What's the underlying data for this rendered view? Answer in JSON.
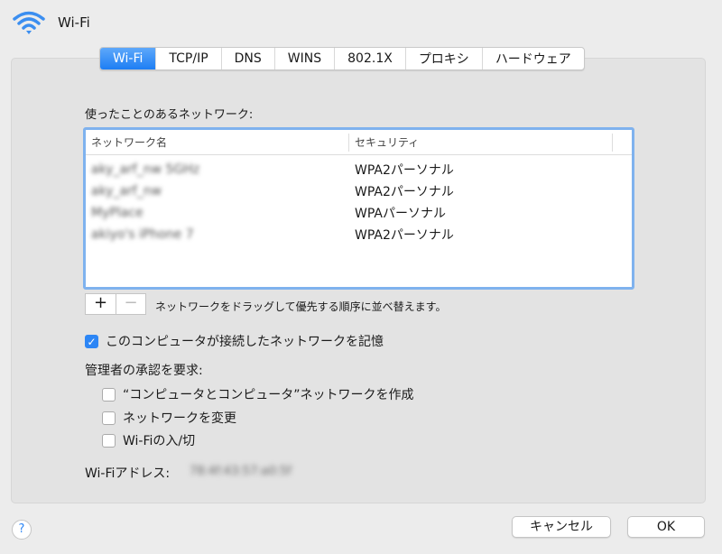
{
  "header": {
    "title": "Wi-Fi",
    "icon": "wifi-icon"
  },
  "tabs": [
    "Wi-Fi",
    "TCP/IP",
    "DNS",
    "WINS",
    "802.1X",
    "プロキシ",
    "ハードウェア"
  ],
  "preferred_label": "使ったことのあるネットワーク:",
  "table": {
    "columns": [
      "ネットワーク名",
      "セキュリティ"
    ],
    "rows": [
      {
        "name": "aky_arf_nw 5GHz",
        "security": "WPA2パーソナル"
      },
      {
        "name": "aky_arf_nw",
        "security": "WPA2パーソナル"
      },
      {
        "name": "MyPlace",
        "security": "WPAパーソナル"
      },
      {
        "name": "akiyo's iPhone 7",
        "security": "WPA2パーソナル"
      }
    ]
  },
  "add_label": "+",
  "remove_label": "−",
  "hint": "ネットワークをドラッグして優先する順序に並べ替えます。",
  "remember": {
    "label": "このコンピュータが接続したネットワークを記憶",
    "checked": true
  },
  "admin_label": "管理者の承認を要求:",
  "admin_options": [
    {
      "label": "“コンピュータとコンピュータ”ネットワークを作成",
      "checked": false
    },
    {
      "label": "ネットワークを変更",
      "checked": false
    },
    {
      "label": "Wi-Fiの入/切",
      "checked": false
    }
  ],
  "address_label": "Wi-Fiアドレス:",
  "address_value": "78:4f:43:57:a0:5f",
  "help_label": "?",
  "cancel_label": "キャンセル",
  "ok_label": "OK"
}
